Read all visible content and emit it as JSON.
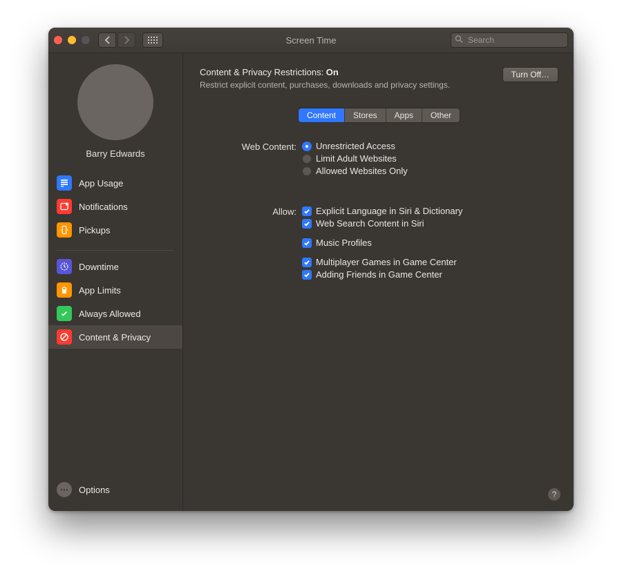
{
  "window": {
    "title": "Screen Time",
    "search_placeholder": "Search"
  },
  "user": {
    "name": "Barry Edwards"
  },
  "sidebar": {
    "section1": [
      {
        "label": "App Usage"
      },
      {
        "label": "Notifications"
      },
      {
        "label": "Pickups"
      }
    ],
    "section2": [
      {
        "label": "Downtime"
      },
      {
        "label": "App Limits"
      },
      {
        "label": "Always Allowed"
      },
      {
        "label": "Content & Privacy"
      }
    ],
    "options_label": "Options"
  },
  "content": {
    "title_prefix": "Content & Privacy Restrictions: ",
    "title_state": "On",
    "subtitle": "Restrict explicit content, purchases, downloads and privacy settings.",
    "turn_off_label": "Turn Off…",
    "tabs": [
      {
        "label": "Content"
      },
      {
        "label": "Stores"
      },
      {
        "label": "Apps"
      },
      {
        "label": "Other"
      }
    ],
    "web_content_label": "Web Content:",
    "web_content_options": [
      "Unrestricted Access",
      "Limit Adult Websites",
      "Allowed Websites Only"
    ],
    "allow_label": "Allow:",
    "allow_group1": [
      "Explicit Language in Siri & Dictionary",
      "Web Search Content in Siri"
    ],
    "allow_group2": [
      "Music Profiles"
    ],
    "allow_group3": [
      "Multiplayer Games in Game Center",
      "Adding Friends in Game Center"
    ],
    "help_label": "?"
  }
}
